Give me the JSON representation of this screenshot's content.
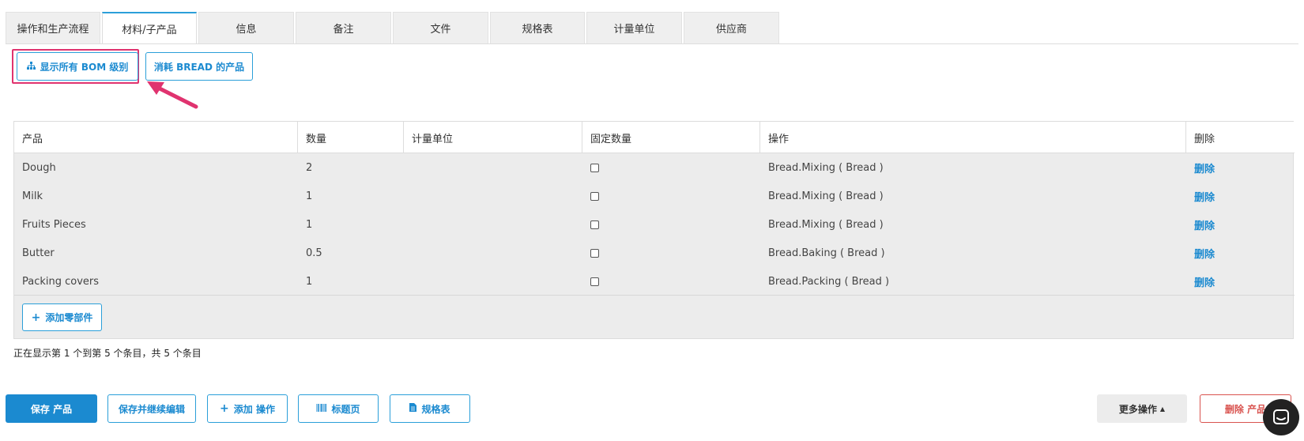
{
  "tabs": [
    {
      "label": "操作和生产流程"
    },
    {
      "label": "材料/子产品"
    },
    {
      "label": "信息"
    },
    {
      "label": "备注"
    },
    {
      "label": "文件"
    },
    {
      "label": "规格表"
    },
    {
      "label": "计量单位"
    },
    {
      "label": "供应商"
    }
  ],
  "top_buttons": {
    "show_bom": "显示所有 BOM 级别",
    "consumers": "消耗 BREAD 的产品"
  },
  "table": {
    "headers": [
      "产品",
      "数量",
      "计量单位",
      "固定数量",
      "操作",
      "删除"
    ],
    "rows": [
      {
        "product": "Dough",
        "qty": "2",
        "unit": "",
        "fixed": false,
        "operation": "Bread.Mixing ( Bread )",
        "delete": "删除"
      },
      {
        "product": "Milk",
        "qty": "1",
        "unit": "",
        "fixed": false,
        "operation": "Bread.Mixing ( Bread )",
        "delete": "删除"
      },
      {
        "product": "Fruits Pieces",
        "qty": "1",
        "unit": "",
        "fixed": false,
        "operation": "Bread.Mixing ( Bread )",
        "delete": "删除"
      },
      {
        "product": "Butter",
        "qty": "0.5",
        "unit": "",
        "fixed": false,
        "operation": "Bread.Baking ( Bread )",
        "delete": "删除"
      },
      {
        "product": "Packing covers",
        "qty": "1",
        "unit": "",
        "fixed": false,
        "operation": "Bread.Packing ( Bread )",
        "delete": "删除"
      }
    ],
    "add_part": "添加零部件"
  },
  "entries_info": "正在显示第 1 个到第 5 个条目，共 5 个条目",
  "bottom_buttons": {
    "save": "保存 产品",
    "save_continue": "保存并继续编辑",
    "add_operation": "添加 操作",
    "title_page": "标题页",
    "spec_sheet": "规格表",
    "more": "更多操作",
    "delete_product": "删除 产品"
  },
  "icons": {
    "bom": "sitemap-icon",
    "plus": "plus-icon",
    "barcode": "barcode-icon",
    "file": "file-icon",
    "caret": "caret-up-icon",
    "chat": "chat-icon",
    "arrow": "annotation-arrow"
  },
  "colors": {
    "accent": "#1b8ad0",
    "highlight": "#e0336f",
    "danger": "#d9534f"
  }
}
